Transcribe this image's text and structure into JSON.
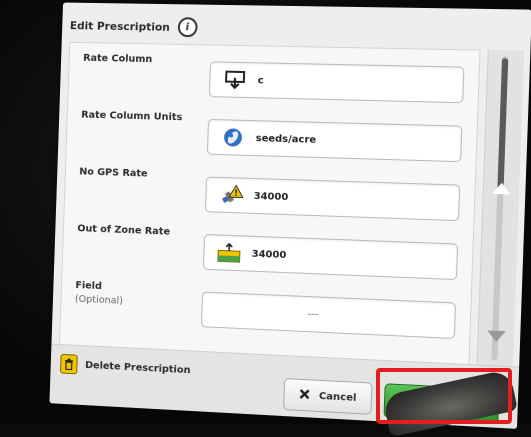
{
  "dialog": {
    "title": "Edit Prescription",
    "info_icon_glyph": "i"
  },
  "fields": [
    {
      "label": "Rate Column",
      "sublabel": "",
      "value": "c",
      "icon": "import-arrow-icon"
    },
    {
      "label": "Rate Column Units",
      "sublabel": "",
      "value": "seeds/acre",
      "icon": "seed-icon"
    },
    {
      "label": "No GPS Rate",
      "sublabel": "",
      "value": "34000",
      "icon": "gps-satellite-warning-icon"
    },
    {
      "label": "Out of Zone Rate",
      "sublabel": "",
      "value": "34000",
      "icon": "field-boundary-icon"
    },
    {
      "label": "Field",
      "sublabel": "(Optional)",
      "value": "---",
      "icon": ""
    }
  ],
  "footer": {
    "delete_label": "Delete Prescription",
    "cancel_label": "Cancel"
  },
  "colors": {
    "accept_green": "#3fa63d",
    "highlight_red": "#e41e1e",
    "warning_yellow": "#f2c400"
  }
}
